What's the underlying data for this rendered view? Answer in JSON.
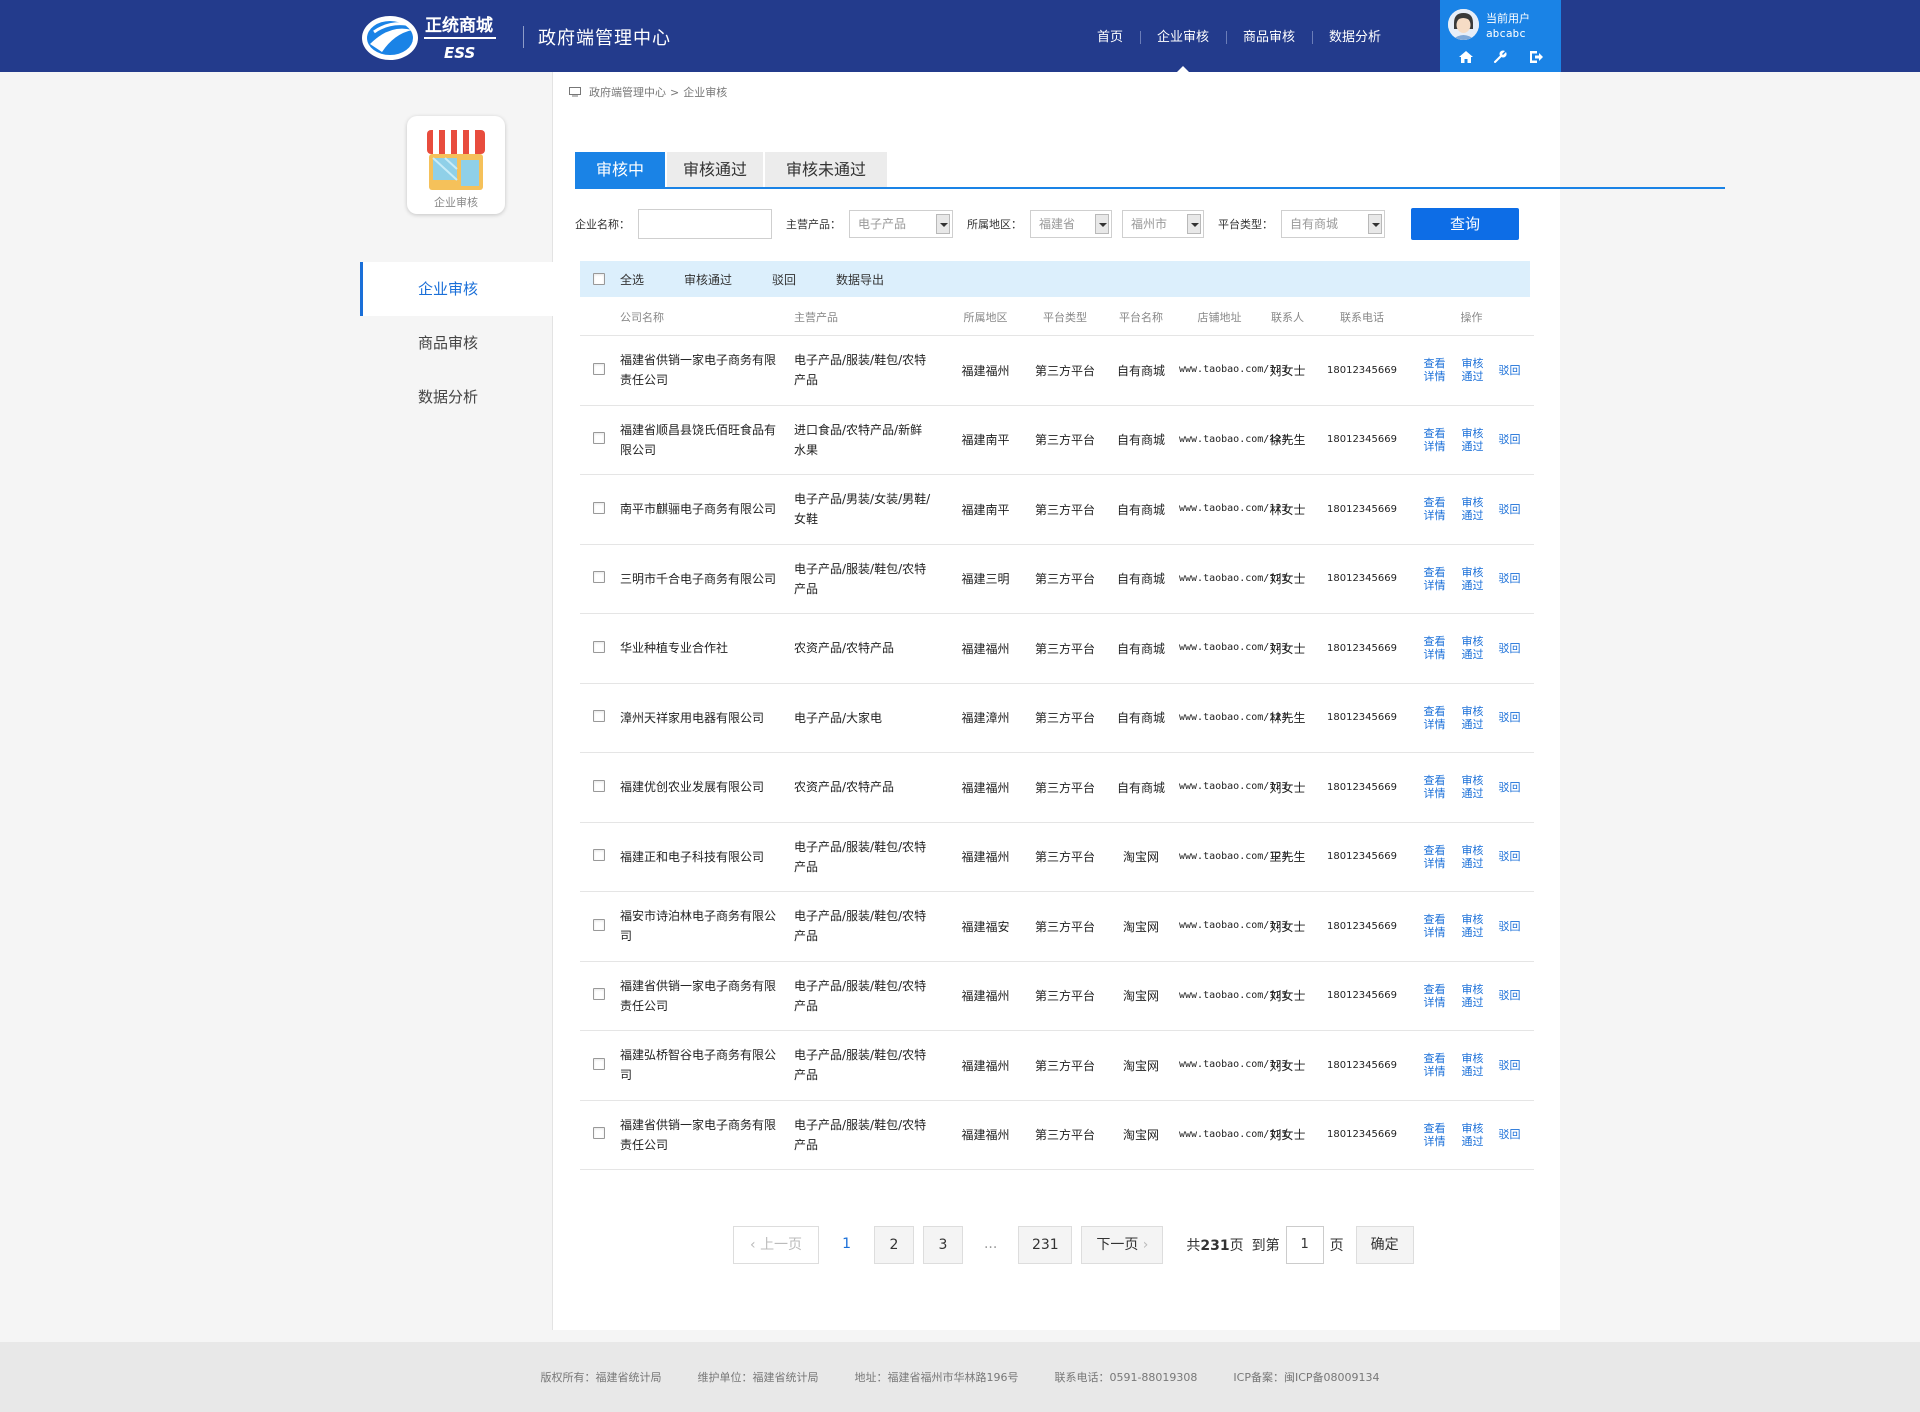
{
  "header": {
    "site_title": "政府端管理中心",
    "logo_text": "正统商城",
    "logo_sub": "ESS",
    "nav": [
      "首页",
      "企业审核",
      "商品审核",
      "数据分析"
    ],
    "active_nav": "企业审核",
    "user_label": "当前用户",
    "user_name": "abcabc",
    "user_icons": [
      "home-icon",
      "wrench-icon",
      "logout-icon"
    ]
  },
  "sidebar": {
    "module_label": "企业审核",
    "items": [
      "企业审核",
      "商品审核",
      "数据分析"
    ],
    "active": "企业审核"
  },
  "breadcrumb": {
    "root": "政府端管理中心",
    "sep": ">",
    "current": "企业审核"
  },
  "tabs": [
    "审核中",
    "审核通过",
    "审核未通过"
  ],
  "active_tab": "审核中",
  "filters": {
    "company_label": "企业名称：",
    "product_label": "主营产品：",
    "product_value": "电子产品",
    "region_label": "所属地区：",
    "province_value": "福建省",
    "city_value": "福州市",
    "platform_label": "平台类型：",
    "platform_value": "自有商城",
    "search_label": "查询"
  },
  "toolbar": {
    "select_all": "全选",
    "approve": "审核通过",
    "reject": "驳回",
    "export": "数据导出"
  },
  "columns": [
    "公司名称",
    "主营产品",
    "所属地区",
    "平台类型",
    "平台名称",
    "店铺地址",
    "联系人",
    "联系电话",
    "操作"
  ],
  "actions": {
    "view": "查看详情",
    "approve": "审核通过",
    "reject": "驳回"
  },
  "rows": [
    {
      "company": "福建省供销一家电子商务有限责任公司",
      "product": "电子产品/服装/鞋包/农特产品",
      "region": "福建福州",
      "platform_type": "第三方平台",
      "platform_name": "自有商城",
      "shop_url": "www.taobao.com/123",
      "contact": "刘女士",
      "phone": "18012345669"
    },
    {
      "company": "福建省顺昌县饶氏佰旺食品有限公司",
      "product": "进口食品/农特产品/新鲜水果",
      "region": "福建南平",
      "platform_type": "第三方平台",
      "platform_name": "自有商城",
      "shop_url": "www.taobao.com/123",
      "contact": "徐先生",
      "phone": "18012345669"
    },
    {
      "company": "南平市麒骊电子商务有限公司",
      "product": "电子产品/男装/女装/男鞋/女鞋",
      "region": "福建南平",
      "platform_type": "第三方平台",
      "platform_name": "自有商城",
      "shop_url": "www.taobao.com/123",
      "contact": "林女士",
      "phone": "18012345669"
    },
    {
      "company": "三明市千合电子商务有限公司",
      "product": "电子产品/服装/鞋包/农特产品",
      "region": "福建三明",
      "platform_type": "第三方平台",
      "platform_name": "自有商城",
      "shop_url": "www.taobao.com/123",
      "contact": "刘女士",
      "phone": "18012345669"
    },
    {
      "company": "华业种植专业合作社",
      "product": "农资产品/农特产品",
      "region": "福建福州",
      "platform_type": "第三方平台",
      "platform_name": "自有商城",
      "shop_url": "www.taobao.com/123",
      "contact": "刘女士",
      "phone": "18012345669"
    },
    {
      "company": "漳州天祥家用电器有限公司",
      "product": "电子产品/大家电",
      "region": "福建漳州",
      "platform_type": "第三方平台",
      "platform_name": "自有商城",
      "shop_url": "www.taobao.com/123",
      "contact": "林先生",
      "phone": "18012345669"
    },
    {
      "company": "福建优创农业发展有限公司",
      "product": "农资产品/农特产品",
      "region": "福建福州",
      "platform_type": "第三方平台",
      "platform_name": "自有商城",
      "shop_url": "www.taobao.com/123",
      "contact": "刘女士",
      "phone": "18012345669"
    },
    {
      "company": "福建正和电子科技有限公司",
      "product": "电子产品/服装/鞋包/农特产品",
      "region": "福建福州",
      "platform_type": "第三方平台",
      "platform_name": "淘宝网",
      "shop_url": "www.taobao.com/123",
      "contact": "王先生",
      "phone": "18012345669"
    },
    {
      "company": "福安市诗泊林电子商务有限公司",
      "product": "电子产品/服装/鞋包/农特产品",
      "region": "福建福安",
      "platform_type": "第三方平台",
      "platform_name": "淘宝网",
      "shop_url": "www.taobao.com/123",
      "contact": "刘女士",
      "phone": "18012345669"
    },
    {
      "company": "福建省供销一家电子商务有限责任公司",
      "product": "电子产品/服装/鞋包/农特产品",
      "region": "福建福州",
      "platform_type": "第三方平台",
      "platform_name": "淘宝网",
      "shop_url": "www.taobao.com/123",
      "contact": "刘女士",
      "phone": "18012345669"
    },
    {
      "company": "福建弘桥智谷电子商务有限公司",
      "product": "电子产品/服装/鞋包/农特产品",
      "region": "福建福州",
      "platform_type": "第三方平台",
      "platform_name": "淘宝网",
      "shop_url": "www.taobao.com/123",
      "contact": "刘女士",
      "phone": "18012345669"
    },
    {
      "company": "福建省供销一家电子商务有限责任公司",
      "product": "电子产品/服装/鞋包/农特产品",
      "region": "福建福州",
      "platform_type": "第三方平台",
      "platform_name": "淘宝网",
      "shop_url": "www.taobao.com/123",
      "contact": "刘女士",
      "phone": "18012345669"
    }
  ],
  "pagination": {
    "prev": "上一页",
    "pages": [
      "1",
      "2",
      "3"
    ],
    "current_page": "1",
    "ellipsis": "...",
    "last_page": "231",
    "next": "下一页",
    "total_prefix": "共",
    "total_pages": "231",
    "total_suffix": "页",
    "goto_prefix": "到第",
    "goto_value": "1",
    "goto_suffix": "页",
    "confirm": "确定"
  },
  "footer": {
    "copyright": "版权所有：福建省统计局",
    "maintainer": "维护单位：福建省统计局",
    "address": "地址：福建省福州市华林路196号",
    "phone": "联系电话：0591-88019308",
    "icp": "ICP备案：闽ICP备08009134"
  },
  "colors": {
    "header_bg": "#233b8c",
    "accent": "#1a83e6",
    "link": "#1a6fd8",
    "toolbar_bg": "#dceffc"
  }
}
